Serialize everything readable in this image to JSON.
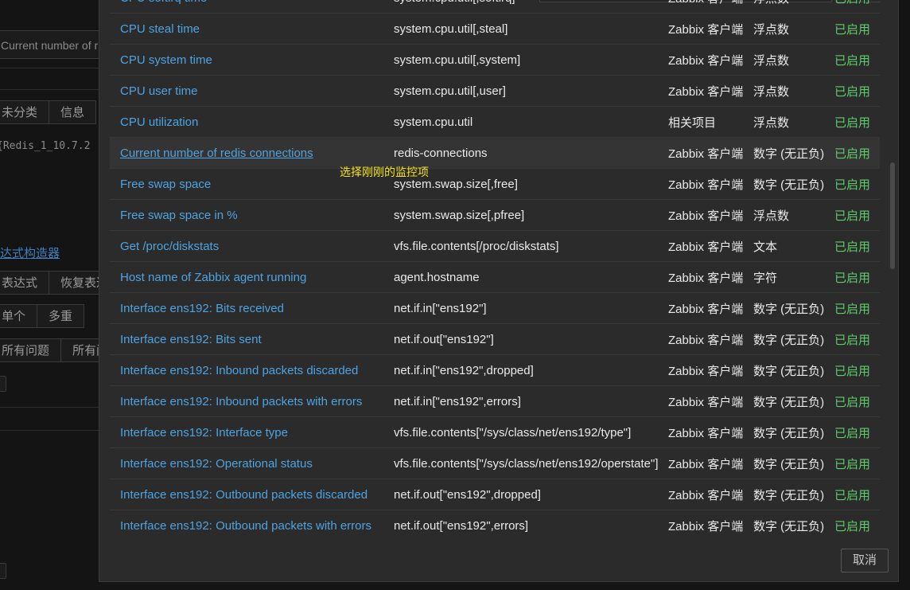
{
  "background": {
    "name_field_value": "Current number of r",
    "tabs_row1": [
      "未分类",
      "信息"
    ],
    "expression_preview": "{Redis_1_10.7.2",
    "expression_builder_link": "达式构造器",
    "tabs_row2": [
      "表达式",
      "恢复表达"
    ],
    "tabs_row3": [
      "单个",
      "多重"
    ],
    "tabs_row4": [
      "所有问题",
      "所有问"
    ]
  },
  "dialog": {
    "cancel_label": "取消",
    "annotation": "选择刚刚的监控项",
    "items": [
      {
        "name": "CPU softirq time",
        "key": "system.cpu.util[,softirq]",
        "type": "Zabbix 客户端",
        "value_type": "浮点数",
        "status": "已启用"
      },
      {
        "name": "CPU steal time",
        "key": "system.cpu.util[,steal]",
        "type": "Zabbix 客户端",
        "value_type": "浮点数",
        "status": "已启用"
      },
      {
        "name": "CPU system time",
        "key": "system.cpu.util[,system]",
        "type": "Zabbix 客户端",
        "value_type": "浮点数",
        "status": "已启用"
      },
      {
        "name": "CPU user time",
        "key": "system.cpu.util[,user]",
        "type": "Zabbix 客户端",
        "value_type": "浮点数",
        "status": "已启用"
      },
      {
        "name": "CPU utilization",
        "key": "system.cpu.util",
        "type": "相关项目",
        "value_type": "浮点数",
        "status": "已启用"
      },
      {
        "name": "Current number of redis connections",
        "key": "redis-connections",
        "type": "Zabbix 客户端",
        "value_type": "数字 (无正负)",
        "status": "已启用"
      },
      {
        "name": "Free swap space",
        "key": "system.swap.size[,free]",
        "type": "Zabbix 客户端",
        "value_type": "数字 (无正负)",
        "status": "已启用"
      },
      {
        "name": "Free swap space in %",
        "key": "system.swap.size[,pfree]",
        "type": "Zabbix 客户端",
        "value_type": "浮点数",
        "status": "已启用"
      },
      {
        "name": "Get /proc/diskstats",
        "key": "vfs.file.contents[/proc/diskstats]",
        "type": "Zabbix 客户端",
        "value_type": "文本",
        "status": "已启用"
      },
      {
        "name": "Host name of Zabbix agent running",
        "key": "agent.hostname",
        "type": "Zabbix 客户端",
        "value_type": "字符",
        "status": "已启用"
      },
      {
        "name": "Interface ens192: Bits received",
        "key": "net.if.in[\"ens192\"]",
        "type": "Zabbix 客户端",
        "value_type": "数字 (无正负)",
        "status": "已启用"
      },
      {
        "name": "Interface ens192: Bits sent",
        "key": "net.if.out[\"ens192\"]",
        "type": "Zabbix 客户端",
        "value_type": "数字 (无正负)",
        "status": "已启用"
      },
      {
        "name": "Interface ens192: Inbound packets discarded",
        "key": "net.if.in[\"ens192\",dropped]",
        "type": "Zabbix 客户端",
        "value_type": "数字 (无正负)",
        "status": "已启用"
      },
      {
        "name": "Interface ens192: Inbound packets with errors",
        "key": "net.if.in[\"ens192\",errors]",
        "type": "Zabbix 客户端",
        "value_type": "数字 (无正负)",
        "status": "已启用"
      },
      {
        "name": "Interface ens192: Interface type",
        "key": "vfs.file.contents[\"/sys/class/net/ens192/type\"]",
        "type": "Zabbix 客户端",
        "value_type": "数字 (无正负)",
        "status": "已启用"
      },
      {
        "name": "Interface ens192: Operational status",
        "key": "vfs.file.contents[\"/sys/class/net/ens192/operstate\"]",
        "type": "Zabbix 客户端",
        "value_type": "数字 (无正负)",
        "status": "已启用"
      },
      {
        "name": "Interface ens192: Outbound packets discarded",
        "key": "net.if.out[\"ens192\",dropped]",
        "type": "Zabbix 客户端",
        "value_type": "数字 (无正负)",
        "status": "已启用"
      },
      {
        "name": "Interface ens192: Outbound packets with errors",
        "key": "net.if.out[\"ens192\",errors]",
        "type": "Zabbix 客户端",
        "value_type": "数字 (无正负)",
        "status": "已启用"
      }
    ]
  }
}
